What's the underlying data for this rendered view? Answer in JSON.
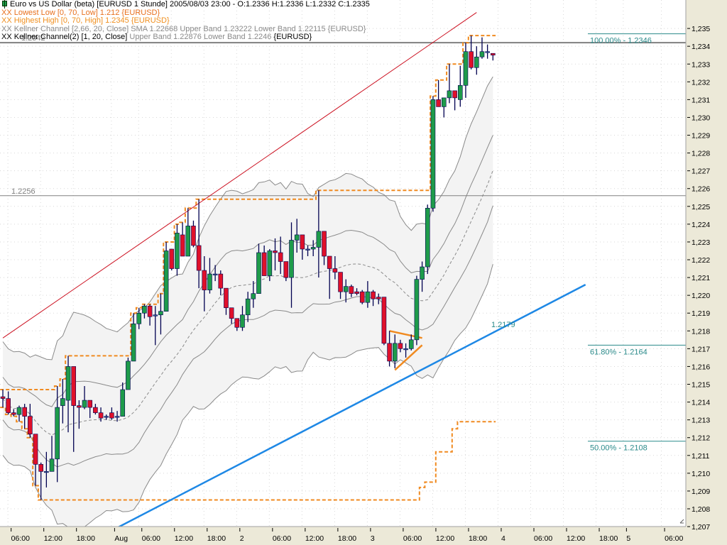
{
  "header": {
    "title": "Euro vs US Dollar (beta) [EURUSD  1 Stunde] 2005/08/03 23:00 - O:1.2336 H:1.2336 L:1.2332 C:1.2335",
    "lowest_low": "XX Lowest Low [0, 70, Low] 1.212 {EURUSD}",
    "highest_high": "XX Highest High [0, 70, High] 1.2345 {EURUSD}",
    "keltner1": "XX Kellner Channel [2,66, 20, Close] SMA 1.22668 Upper Band 1.23222 Lower Band 1.22115 {EURUSD}",
    "keltner2_a": "XX Kellner Channel(2) [1, 20, Close] ",
    "keltner2_b": "Upper Band 1.22876 Lower Band 1.2246 ",
    "keltner2_c": "{EURUSD}"
  },
  "colors": {
    "up": "#1e9b4a",
    "down": "#e0102a",
    "wick": "#000050",
    "orange": "#f08a20",
    "teal": "#2a8a8a",
    "trend_blue": "#1e88e5",
    "trend_red": "#cc1020",
    "band": "#8a8a8a",
    "axis_bg": "#ece9d8"
  },
  "chart_data": {
    "type": "candlestick",
    "symbol": "EURUSD",
    "timeframe": "1 Stunde",
    "ylim": [
      1.2062,
      1.2366
    ],
    "y_ticks": [
      "1,235",
      "1,234",
      "1,233",
      "1,232",
      "1,231",
      "1,230",
      "1,229",
      "1,228",
      "1,227",
      "1,226",
      "1,225",
      "1,224",
      "1,223",
      "1,222",
      "1,221",
      "1,220",
      "1,219",
      "1,218",
      "1,217",
      "1,216",
      "1,215",
      "1,214",
      "1,213",
      "1,212",
      "1,211",
      "1,210",
      "1,209",
      "1,208",
      "1,207"
    ],
    "x_ticks": [
      {
        "label": "06:00",
        "bar": 1
      },
      {
        "label": "12:00",
        "bar": 7
      },
      {
        "label": "18:00",
        "bar": 13
      },
      {
        "label": "Aug",
        "bar": 20
      },
      {
        "label": "06:00",
        "bar": 25
      },
      {
        "label": "12:00",
        "bar": 31
      },
      {
        "label": "18:00",
        "bar": 37
      },
      {
        "label": "2",
        "bar": 43
      },
      {
        "label": "06:00",
        "bar": 49
      },
      {
        "label": "12:00",
        "bar": 55
      },
      {
        "label": "18:00",
        "bar": 61
      },
      {
        "label": "3",
        "bar": 67
      },
      {
        "label": "06:00",
        "bar": 73
      },
      {
        "label": "12:00",
        "bar": 79
      },
      {
        "label": "18:00",
        "bar": 85
      },
      {
        "label": "4",
        "bar": 91
      },
      {
        "label": "06:00",
        "bar": 97
      },
      {
        "label": "12:00",
        "bar": 103
      },
      {
        "label": "18:00",
        "bar": 109
      },
      {
        "label": "5",
        "bar": 114
      },
      {
        "label": "06:00",
        "bar": 121
      }
    ],
    "ohlc": [
      [
        1.2143,
        1.2147,
        1.2137,
        1.2142
      ],
      [
        1.2142,
        1.2146,
        1.2133,
        1.2134
      ],
      [
        1.2134,
        1.2136,
        1.2132,
        1.2133
      ],
      [
        1.2133,
        1.2138,
        1.2129,
        1.2137
      ],
      [
        1.2137,
        1.2139,
        1.2125,
        1.2132
      ],
      [
        1.2132,
        1.2139,
        1.212,
        1.2122
      ],
      [
        1.2122,
        1.2122,
        1.2093,
        1.2105
      ],
      [
        1.2105,
        1.2106,
        1.2085,
        1.2101
      ],
      [
        1.2101,
        1.2112,
        1.2092,
        1.2101
      ],
      [
        1.2101,
        1.2121,
        1.2101,
        1.2108
      ],
      [
        1.2108,
        1.2149,
        1.2095,
        1.2137
      ],
      [
        1.2138,
        1.2153,
        1.2128,
        1.2142
      ],
      [
        1.2141,
        1.2166,
        1.2123,
        1.216
      ],
      [
        1.216,
        1.216,
        1.2112,
        1.2138
      ],
      [
        1.2138,
        1.2141,
        1.2125,
        1.2137
      ],
      [
        1.2137,
        1.2149,
        1.2136,
        1.2141
      ],
      [
        1.2141,
        1.2141,
        1.2131,
        1.2137
      ],
      [
        1.2137,
        1.2139,
        1.2133,
        1.2134
      ],
      [
        1.2134,
        1.2137,
        1.2129,
        1.2131
      ],
      [
        1.2132,
        1.2133,
        1.213,
        1.2132
      ],
      [
        1.2134,
        1.2137,
        1.213,
        1.2131
      ],
      [
        1.2132,
        1.2135,
        1.2129,
        1.2132
      ],
      [
        1.2132,
        1.2151,
        1.2132,
        1.2147
      ],
      [
        1.2147,
        1.2165,
        1.2147,
        1.2163
      ],
      [
        1.2163,
        1.219,
        1.2163,
        1.2184
      ],
      [
        1.2184,
        1.2193,
        1.2181,
        1.219
      ],
      [
        1.219,
        1.2195,
        1.2187,
        1.2194
      ],
      [
        1.2194,
        1.2195,
        1.2183,
        1.2188
      ],
      [
        1.2189,
        1.2194,
        1.2172,
        1.2189
      ],
      [
        1.2189,
        1.2201,
        1.2178,
        1.2191
      ],
      [
        1.2191,
        1.223,
        1.2191,
        1.2225
      ],
      [
        1.2226,
        1.2226,
        1.2214,
        1.2215
      ],
      [
        1.2215,
        1.224,
        1.2211,
        1.2235
      ],
      [
        1.2234,
        1.2241,
        1.2222,
        1.2222
      ],
      [
        1.2222,
        1.2249,
        1.2222,
        1.2239
      ],
      [
        1.2239,
        1.2242,
        1.2227,
        1.2228
      ],
      [
        1.2228,
        1.2254,
        1.2204,
        1.2214
      ],
      [
        1.2214,
        1.2222,
        1.2191,
        1.2203
      ],
      [
        1.2203,
        1.2221,
        1.2201,
        1.2212
      ],
      [
        1.2212,
        1.2217,
        1.2208,
        1.2212
      ],
      [
        1.2212,
        1.2214,
        1.22,
        1.2204
      ],
      [
        1.2204,
        1.2204,
        1.2189,
        1.2193
      ],
      [
        1.2193,
        1.2193,
        1.2184,
        1.2187
      ],
      [
        1.2187,
        1.2187,
        1.218,
        1.2182
      ],
      [
        1.2182,
        1.2194,
        1.218,
        1.2189
      ],
      [
        1.2189,
        1.2202,
        1.2185,
        1.2198
      ],
      [
        1.2198,
        1.2208,
        1.2193,
        1.2201
      ],
      [
        1.2201,
        1.2229,
        1.2201,
        1.2224
      ],
      [
        1.2224,
        1.2228,
        1.2211,
        1.2211
      ],
      [
        1.2211,
        1.2226,
        1.2208,
        1.2225
      ],
      [
        1.2225,
        1.2232,
        1.2214,
        1.2224
      ],
      [
        1.2224,
        1.2233,
        1.2212,
        1.2219
      ],
      [
        1.2219,
        1.2219,
        1.2208,
        1.221
      ],
      [
        1.221,
        1.2241,
        1.2193,
        1.2231
      ],
      [
        1.2231,
        1.2243,
        1.2224,
        1.2234
      ],
      [
        1.2234,
        1.2234,
        1.222,
        1.2226
      ],
      [
        1.2226,
        1.2228,
        1.2222,
        1.2226
      ],
      [
        1.2226,
        1.2231,
        1.2222,
        1.2227
      ],
      [
        1.2227,
        1.2259,
        1.221,
        1.2236
      ],
      [
        1.2236,
        1.2236,
        1.2217,
        1.2222
      ],
      [
        1.2222,
        1.2222,
        1.2198,
        1.2215
      ],
      [
        1.2215,
        1.2222,
        1.2209,
        1.2213
      ],
      [
        1.2213,
        1.2213,
        1.2198,
        1.2202
      ],
      [
        1.2202,
        1.2209,
        1.2196,
        1.2205
      ],
      [
        1.2205,
        1.2206,
        1.2199,
        1.2201
      ],
      [
        1.2202,
        1.2204,
        1.22,
        1.2201
      ],
      [
        1.2202,
        1.2203,
        1.2195,
        1.2196
      ],
      [
        1.2196,
        1.2208,
        1.2193,
        1.2202
      ],
      [
        1.2202,
        1.2203,
        1.2194,
        1.2198
      ],
      [
        1.2199,
        1.2201,
        1.2195,
        1.2198
      ],
      [
        1.2199,
        1.2199,
        1.2172,
        1.2173
      ],
      [
        1.2173,
        1.218,
        1.216,
        1.2163
      ],
      [
        1.2163,
        1.2178,
        1.2159,
        1.2173
      ],
      [
        1.2173,
        1.2175,
        1.2168,
        1.217
      ],
      [
        1.217,
        1.2173,
        1.2165,
        1.217
      ],
      [
        1.217,
        1.2178,
        1.2169,
        1.2175
      ],
      [
        1.2175,
        1.2211,
        1.2172,
        1.2209
      ],
      [
        1.2209,
        1.2219,
        1.2202,
        1.2216
      ],
      [
        1.2216,
        1.2251,
        1.2212,
        1.2249
      ],
      [
        1.2249,
        1.2312,
        1.2247,
        1.231
      ],
      [
        1.231,
        1.2321,
        1.2306,
        1.2306
      ],
      [
        1.2306,
        1.2311,
        1.23,
        1.2311
      ],
      [
        1.2311,
        1.233,
        1.2308,
        1.2315
      ],
      [
        1.2315,
        1.2315,
        1.2304,
        1.2311
      ],
      [
        1.231,
        1.2329,
        1.2306,
        1.2318
      ],
      [
        1.2318,
        1.2342,
        1.2311,
        1.2337
      ],
      [
        1.2337,
        1.2346,
        1.2327,
        1.2328
      ],
      [
        1.2328,
        1.234,
        1.2324,
        1.2334
      ],
      [
        1.2334,
        1.2345,
        1.2333,
        1.2337
      ],
      [
        1.2337,
        1.2341,
        1.2333,
        1.2337
      ],
      [
        1.2336,
        1.2336,
        1.2332,
        1.2335
      ]
    ],
    "highest_high_period": 70,
    "lowest_low_period": 70,
    "keltner": [
      {
        "k": 2.66,
        "period": 20
      },
      {
        "k": 1,
        "period": 20
      }
    ],
    "horizontal_lines": [
      {
        "price": 1.2342,
        "label": "1.2342"
      },
      {
        "price": 1.2256,
        "label": "1.2256"
      }
    ],
    "trendlines": [
      {
        "name": "support",
        "from": {
          "bar": 17,
          "price": 1.2063
        },
        "to": {
          "bar": 107,
          "price": 1.2206
        },
        "label": "1.2179"
      },
      {
        "name": "resistance",
        "from": {
          "bar": 0,
          "price": 1.2176
        },
        "to": {
          "bar": 87,
          "price": 1.2359
        }
      }
    ],
    "fibonacci": [
      {
        "label": "100.00% - 1.2346",
        "price": 1.2347
      },
      {
        "label": "61.80% - 1.2164",
        "price": 1.2172
      },
      {
        "label": "50.00% - 1.2108",
        "price": 1.2118
      }
    ],
    "triangle": [
      {
        "from": {
          "bar": 71,
          "price": 1.218
        },
        "to": {
          "bar": 77,
          "price": 1.2176
        }
      },
      {
        "from": {
          "bar": 72,
          "price": 1.2158
        },
        "to": {
          "bar": 77,
          "price": 1.2172
        }
      }
    ]
  }
}
